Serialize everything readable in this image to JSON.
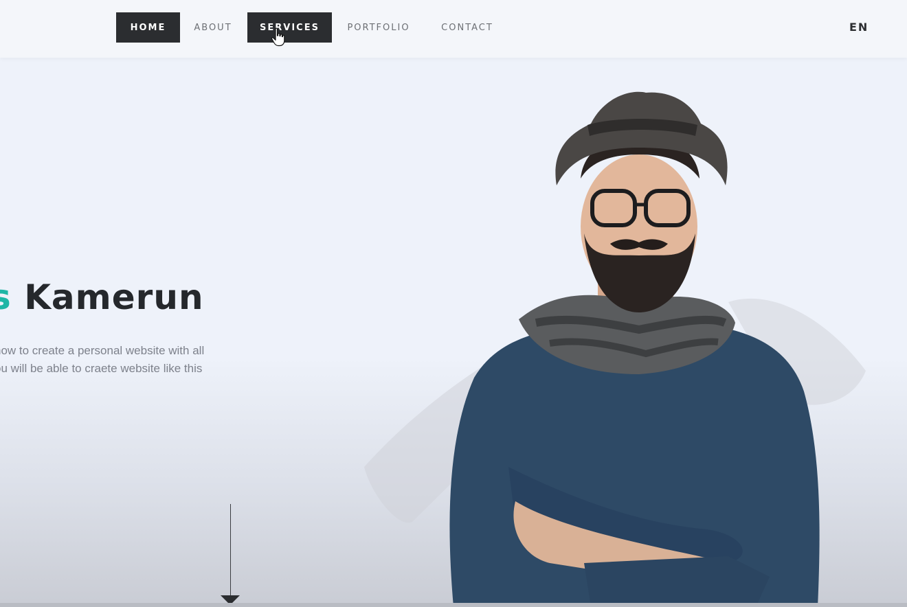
{
  "nav": {
    "items": [
      {
        "label": "HOME"
      },
      {
        "label": "ABOUT"
      },
      {
        "label": "SERVICES"
      },
      {
        "label": "PORTFOLIO"
      },
      {
        "label": "CONTACT"
      }
    ],
    "language": "EN"
  },
  "hero": {
    "name_prefix": "s",
    "name": "Kamerun",
    "description_line1": "how to create a personal website with all",
    "description_line2": "ou will be able to craete website like this"
  },
  "colors": {
    "nav_active_bg": "#2b2d30",
    "accent": "#1fb6a6",
    "shirt": "#2e4a66"
  },
  "icons": {
    "cursor": "hand-pointer-icon",
    "scroll": "arrow-down-icon"
  }
}
